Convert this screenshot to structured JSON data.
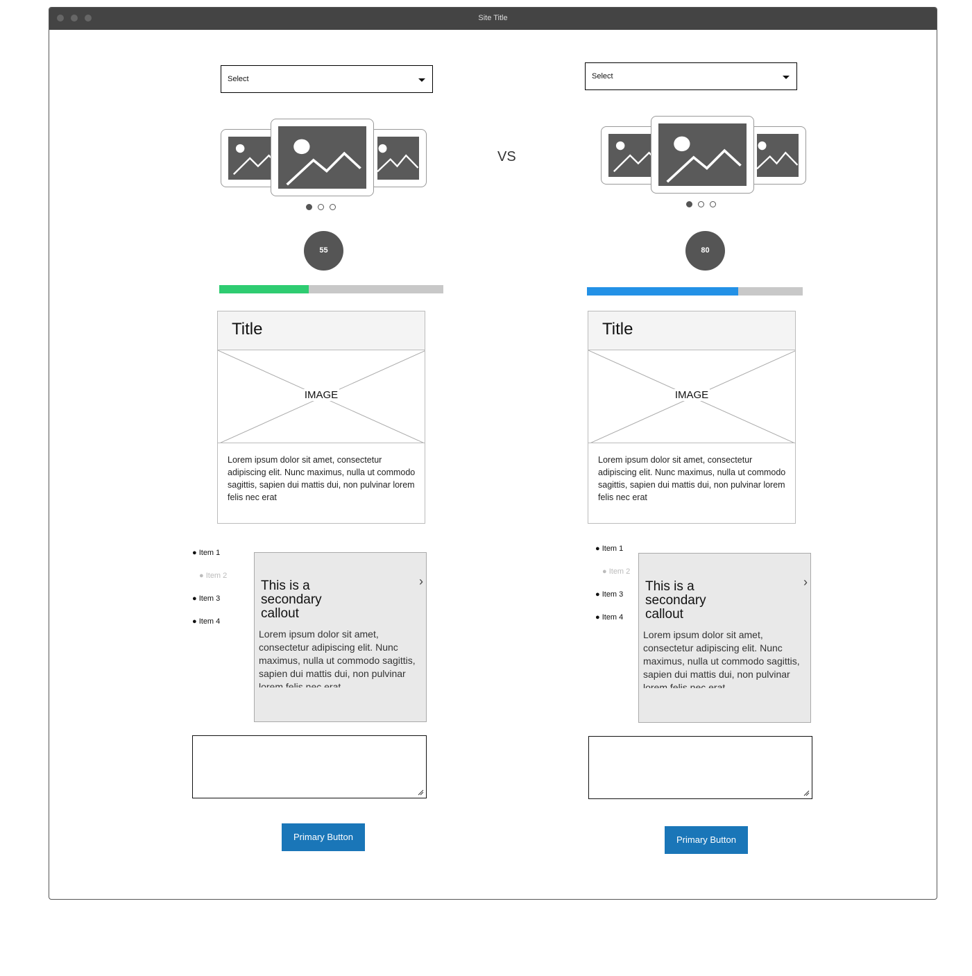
{
  "window": {
    "title": "Site Title"
  },
  "vs_label": "VS",
  "left": {
    "select": "Select",
    "carousel": {
      "active_index": 0,
      "count": 3
    },
    "score": "55",
    "progress": {
      "value": 0.4,
      "color": "#2ecc71"
    },
    "card": {
      "title": "Title",
      "image_label": "IMAGE",
      "body": "Lorem ipsum dolor sit amet, consectetur adipiscing elit. Nunc maximus, nulla ut commodo sagittis, sapien dui mattis dui, non pulvinar lorem felis nec erat"
    },
    "list": [
      "Item 1",
      "Item 2",
      "Item 3",
      "Item 4"
    ],
    "callout": {
      "title": "This is a secondary callout",
      "body": "Lorem ipsum dolor sit amet, consectetur adipiscing elit. Nunc maximus, nulla ut commodo sagittis, sapien dui mattis dui, non pulvinar lorem felis nec erat"
    },
    "button": "Primary Button"
  },
  "right": {
    "select": "Select",
    "carousel": {
      "active_index": 0,
      "count": 3
    },
    "score": "80",
    "progress": {
      "value": 0.7,
      "color": "#2391e6"
    },
    "card": {
      "title": "Title",
      "image_label": "IMAGE",
      "body": "Lorem ipsum dolor sit amet, consectetur adipiscing elit. Nunc maximus, nulla ut commodo sagittis, sapien dui mattis dui, non pulvinar lorem felis nec erat"
    },
    "list": [
      "Item 1",
      "Item 2",
      "Item 3",
      "Item 4"
    ],
    "callout": {
      "title": "This is a secondary callout",
      "body": "Lorem ipsum dolor sit amet, consectetur adipiscing elit. Nunc maximus, nulla ut commodo sagittis, sapien dui mattis dui, non pulvinar lorem felis nec erat"
    },
    "button": "Primary Button"
  }
}
